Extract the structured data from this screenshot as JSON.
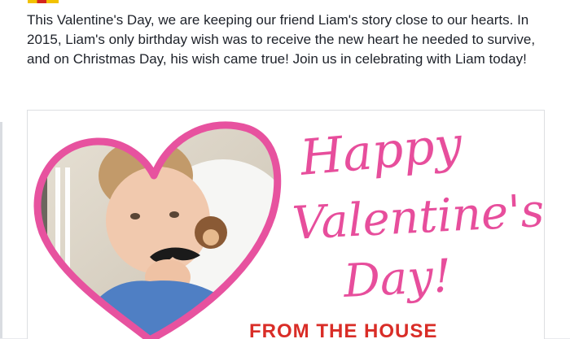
{
  "post": {
    "text": "This Valentine's Day, we are keeping our friend Liam's story close to our hearts. In 2015, Liam's only birthday wish was to receive the new heart he needed to survive, and on Christmas Day, his wish came true! Join us in celebrating with Liam today!"
  },
  "card": {
    "line1": "Happy",
    "line2": "Valentine's",
    "line3": "Day!",
    "footer": "FROM THE HOUSE"
  },
  "colors": {
    "heart": "#e74e9c",
    "footer": "#d92d27",
    "text": "#1d2129"
  },
  "icons": [
    "flag-icon"
  ]
}
